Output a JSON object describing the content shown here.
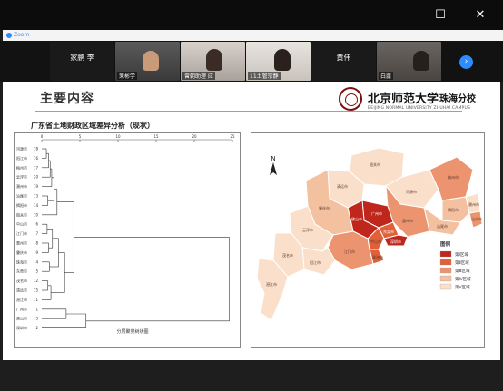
{
  "window": {
    "app_name": "Zoom",
    "minimize": "—",
    "maximize": "☐",
    "close": "✕"
  },
  "participants": [
    {
      "name": "家鹏 李",
      "type": "name-only"
    },
    {
      "name": "茉彬学",
      "type": "video"
    },
    {
      "name": "曾朝助理 应",
      "type": "video"
    },
    {
      "name": "11土管宗静",
      "type": "video"
    },
    {
      "name": "黄伟",
      "type": "name-only"
    },
    {
      "name": "白露",
      "type": "video"
    }
  ],
  "slide": {
    "title": "主要内容",
    "logo_cn": "北京师范大学",
    "logo_campus": "珠海分校",
    "logo_en": "BEIJING NORMAL UNIVERSITY ZHUHAI CAMPUS",
    "section_title": "广东省土地财政区域差异分析（现状）",
    "dendro_caption": "分层聚类树状图",
    "axis_ticks": [
      "0",
      "5",
      "10",
      "15",
      "20",
      "25"
    ],
    "leaves": [
      {
        "name": "河源市",
        "idx": "18"
      },
      {
        "name": "阳江市",
        "idx": "16"
      },
      {
        "name": "梅州市",
        "idx": "17"
      },
      {
        "name": "云浮市",
        "idx": "20"
      },
      {
        "name": "潮州市",
        "idx": "19"
      },
      {
        "name": "汕尾市",
        "idx": "13"
      },
      {
        "name": "揭阳市",
        "idx": "14"
      },
      {
        "name": "韶关市",
        "idx": "10"
      },
      {
        "name": "中山市",
        "idx": "6"
      },
      {
        "name": "江门市",
        "idx": "7"
      },
      {
        "name": "惠州市",
        "idx": "8"
      },
      {
        "name": "肇庆市",
        "idx": "9"
      },
      {
        "name": "珠海市",
        "idx": "4"
      },
      {
        "name": "东莞市",
        "idx": "5"
      },
      {
        "name": "茂名市",
        "idx": "12"
      },
      {
        "name": "清远市",
        "idx": "15"
      },
      {
        "name": "湛江市",
        "idx": "11"
      },
      {
        "name": "广州市",
        "idx": "1"
      },
      {
        "name": "佛山市",
        "idx": "3"
      },
      {
        "name": "深圳市",
        "idx": "2"
      }
    ],
    "map": {
      "north": "N",
      "legend_title": "图例",
      "legend": [
        {
          "label": "第Ⅰ区域",
          "color": "#c0271c"
        },
        {
          "label": "第Ⅱ区域",
          "color": "#e0603a"
        },
        {
          "label": "第Ⅲ区域",
          "color": "#ec9470"
        },
        {
          "label": "第Ⅳ区域",
          "color": "#f3c0a0"
        },
        {
          "label": "第Ⅴ区域",
          "color": "#fae0cb"
        }
      ],
      "cities": [
        {
          "name": "韶关市"
        },
        {
          "name": "清远市"
        },
        {
          "name": "河源市"
        },
        {
          "name": "梅州市"
        },
        {
          "name": "潮州市"
        },
        {
          "name": "汕头市"
        },
        {
          "name": "揭阳市"
        },
        {
          "name": "汕尾市"
        },
        {
          "name": "惠州市"
        },
        {
          "name": "广州市"
        },
        {
          "name": "东莞市"
        },
        {
          "name": "深圳市"
        },
        {
          "name": "佛山市"
        },
        {
          "name": "肇庆市"
        },
        {
          "name": "云浮市"
        },
        {
          "name": "中山市"
        },
        {
          "name": "珠海市"
        },
        {
          "name": "江门市"
        },
        {
          "name": "阳江市"
        },
        {
          "name": "茂名市"
        },
        {
          "name": "湛江市"
        }
      ]
    }
  }
}
